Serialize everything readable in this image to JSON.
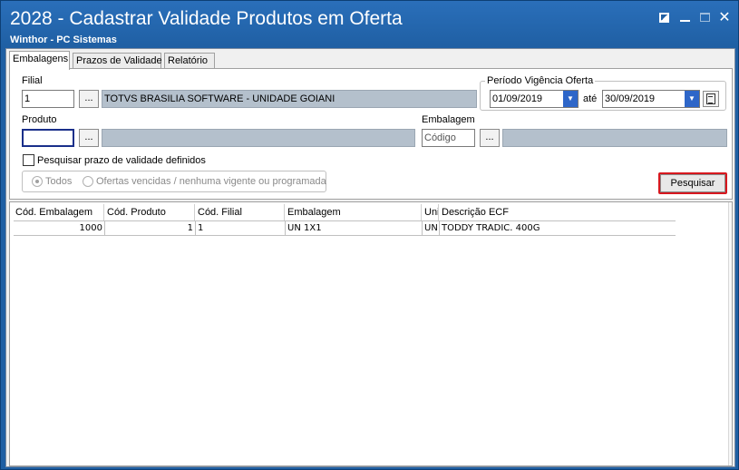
{
  "window": {
    "title": "2028 - Cadastrar Validade Produtos em Oferta",
    "subtitle": "Winthor - PC Sistemas"
  },
  "tabs": [
    {
      "label": "Embalagens",
      "active": true
    },
    {
      "label": "Prazos de Validade",
      "active": false
    },
    {
      "label": "Relatório",
      "active": false
    }
  ],
  "form": {
    "filial": {
      "label": "Filial",
      "code": "1",
      "button": "...",
      "name": "TOTVS BRASILIA SOFTWARE - UNIDADE GOIANI"
    },
    "periodo": {
      "label": "Período Vigência Oferta",
      "start": "01/09/2019",
      "separator": "até",
      "end": "30/09/2019"
    },
    "produto": {
      "label": "Produto",
      "code": "",
      "button": "...",
      "name": ""
    },
    "embalagem": {
      "label": "Embalagem",
      "placeholder": "Código",
      "button": "...",
      "name": ""
    },
    "checkbox_label": "Pesquisar prazo de validade definidos",
    "radios": [
      {
        "label": "Todos",
        "checked": true
      },
      {
        "label": "Ofertas vencidas / nenhuma vigente ou programada",
        "checked": false
      }
    ],
    "search_button": "Pesquisar"
  },
  "grid": {
    "columns": [
      "Cód. Embalagem",
      "Cód. Produto",
      "Cód. Filial",
      "Embalagem",
      "Uni",
      "Descrição ECF"
    ],
    "rows": [
      [
        "1000",
        "1",
        "1",
        "UN 1X1",
        "UN",
        "TODDY TRADIC. 400G"
      ]
    ]
  },
  "colors": {
    "title_bar": "#1f5fa3",
    "highlight": "#d7181f",
    "readonly_field": "#b4c0cc",
    "dropdown": "#2e66c8"
  }
}
